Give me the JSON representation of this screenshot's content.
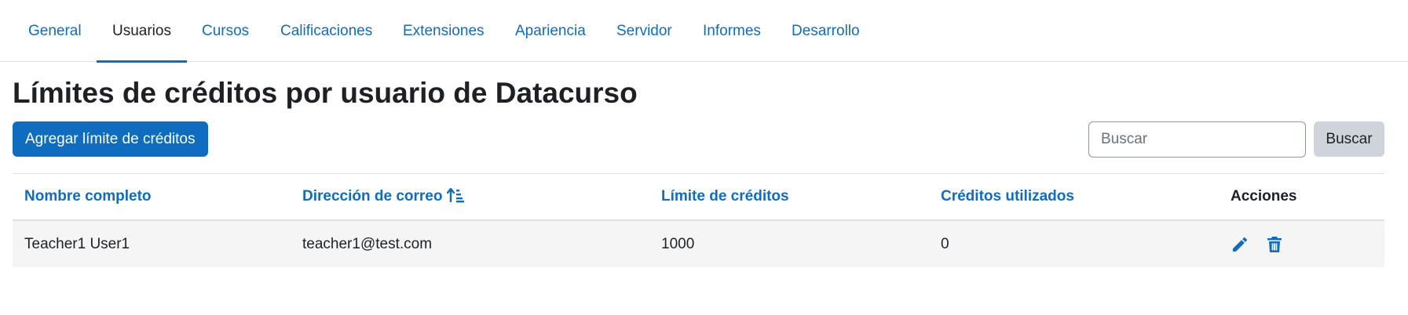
{
  "nav": {
    "tabs": [
      {
        "label": "General"
      },
      {
        "label": "Usuarios",
        "active": true
      },
      {
        "label": "Cursos"
      },
      {
        "label": "Calificaciones"
      },
      {
        "label": "Extensiones"
      },
      {
        "label": "Apariencia"
      },
      {
        "label": "Servidor"
      },
      {
        "label": "Informes"
      },
      {
        "label": "Desarrollo"
      }
    ]
  },
  "page": {
    "title": "Límites de créditos por usuario de Datacurso",
    "add_button_label": "Agregar límite de créditos"
  },
  "search": {
    "placeholder": "Buscar",
    "value": "",
    "button_label": "Buscar"
  },
  "table": {
    "columns": [
      "Nombre completo",
      "Dirección de correo",
      "Límite de créditos",
      "Créditos utilizados",
      "Acciones"
    ],
    "sorted_column": "Dirección de correo",
    "sort_direction": "ascending",
    "rows": [
      {
        "cells": [
          "Teacher1 User1",
          "teacher1@test.com",
          "1000",
          "0"
        ],
        "actions": [
          "pencil-icon",
          "trash-icon"
        ]
      }
    ]
  },
  "colors": {
    "accent": "#0f6cbf",
    "text": "#1d2125",
    "secondary_button": "#ced4da",
    "row_background": "#f5f5f5",
    "border": "#dee2e6"
  }
}
